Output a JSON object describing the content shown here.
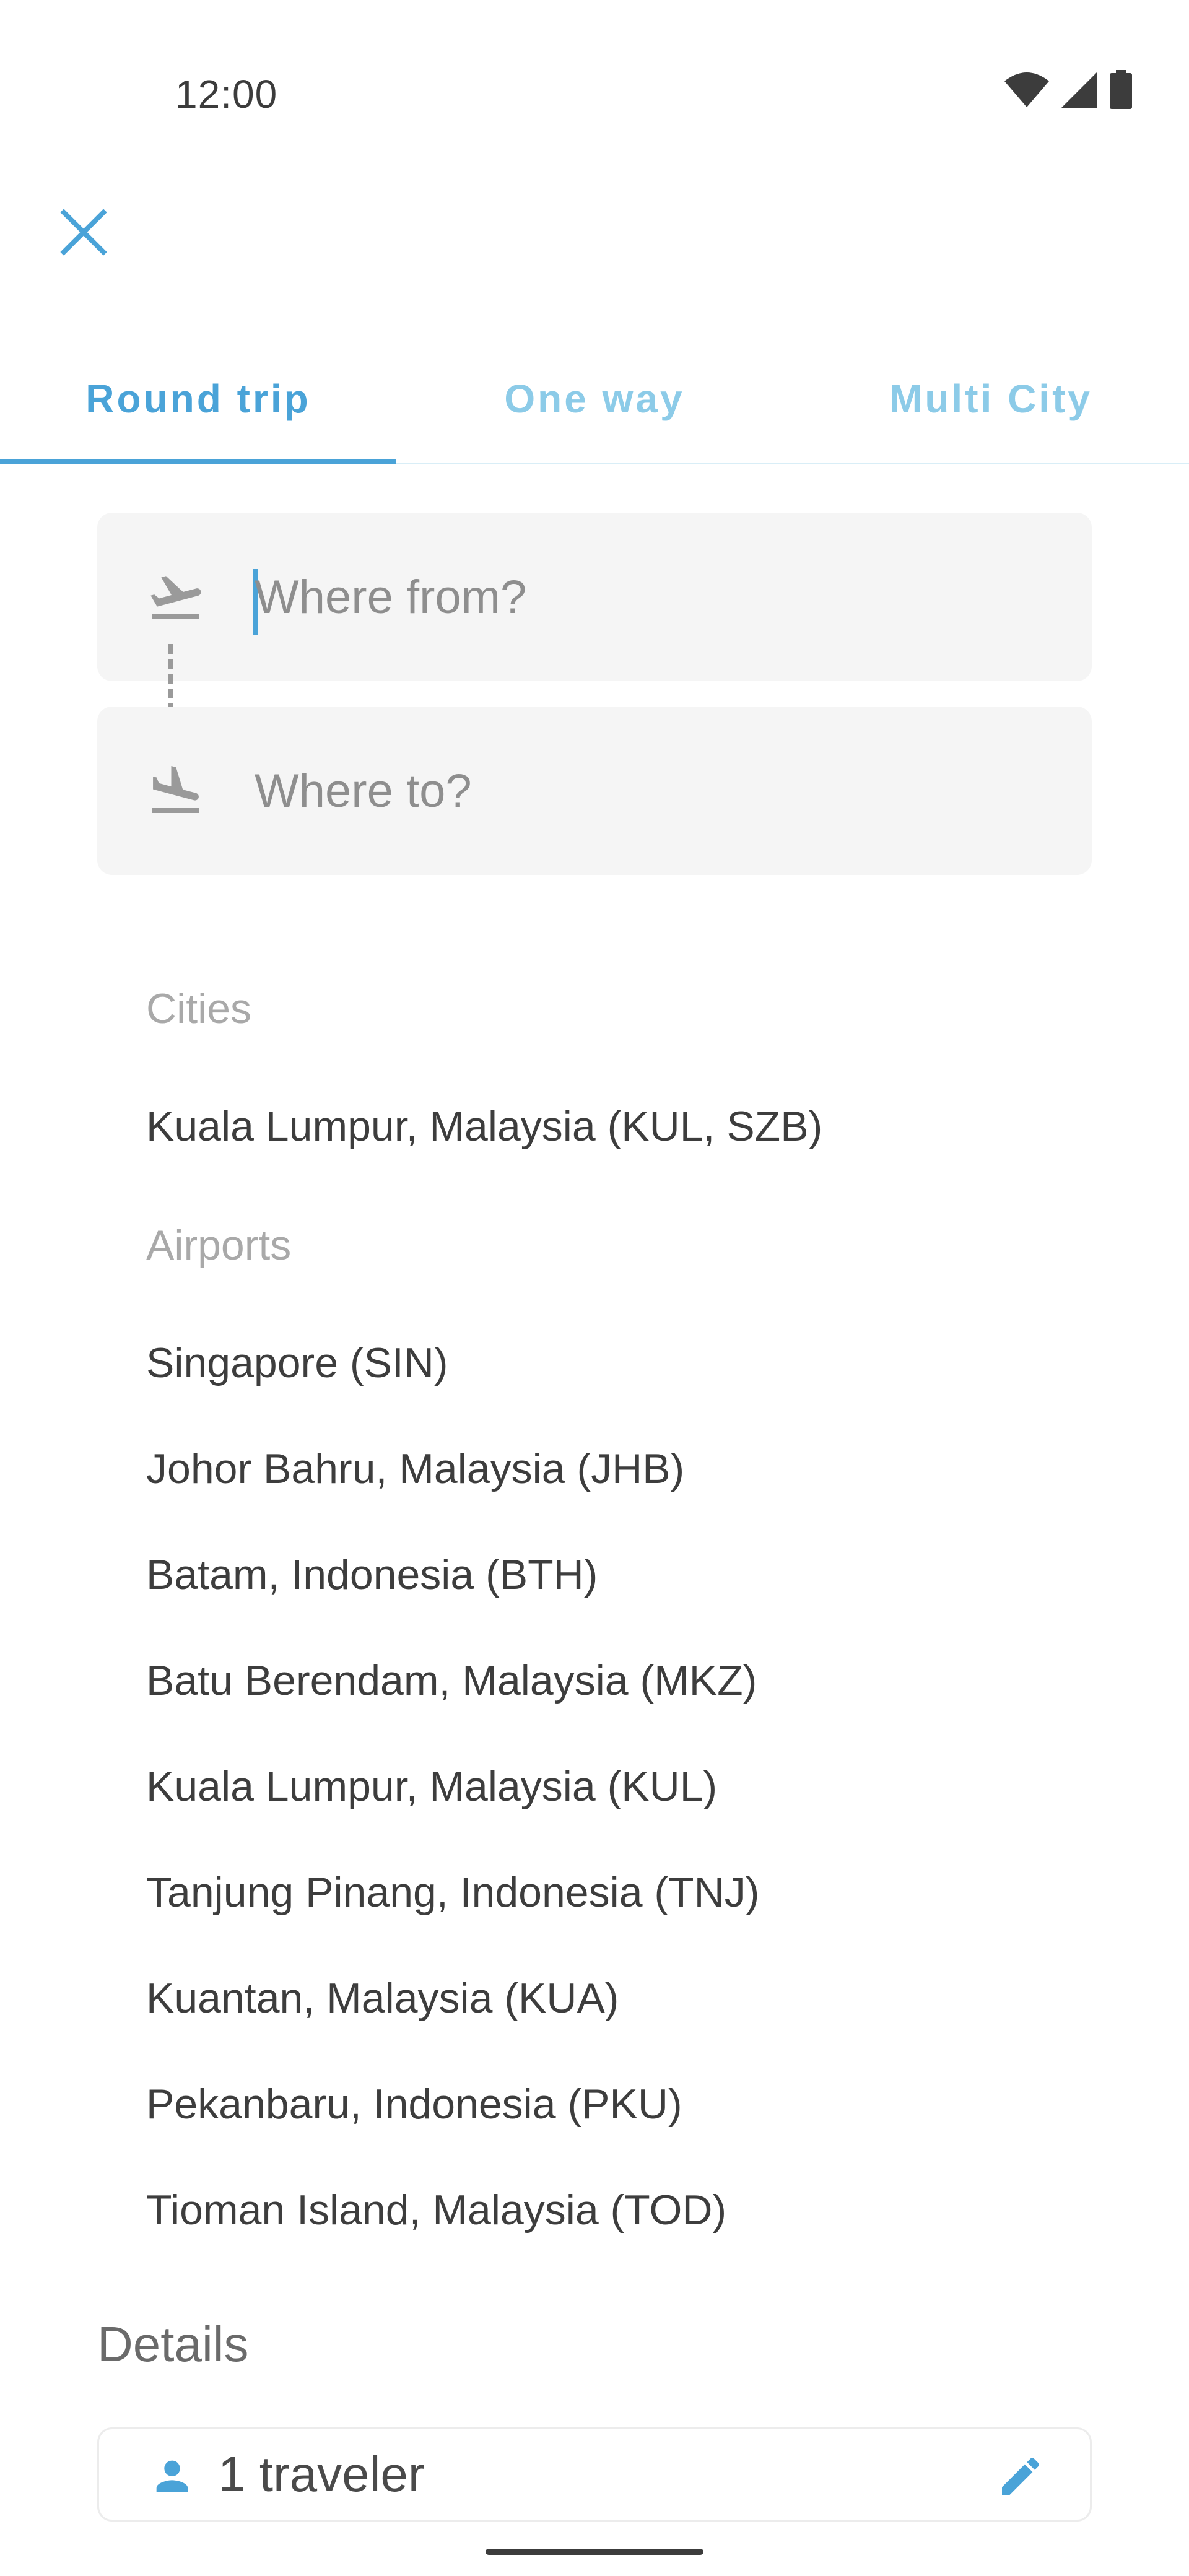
{
  "status_bar": {
    "time": "12:00",
    "icons": [
      "wifi-icon",
      "cellular-signal-icon",
      "battery-icon"
    ]
  },
  "header": {
    "close_icon": "close-icon"
  },
  "tabs": [
    {
      "label": "Round trip",
      "active": true
    },
    {
      "label": "One way",
      "active": false
    },
    {
      "label": "Multi City",
      "active": false
    }
  ],
  "search": {
    "from_placeholder": "Where from?",
    "to_placeholder": "Where to?",
    "from_icon": "flight-takeoff-icon",
    "to_icon": "flight-land-icon"
  },
  "results": {
    "cities_label": "Cities",
    "cities": [
      "Kuala Lumpur, Malaysia (KUL, SZB)"
    ],
    "airports_label": "Airports",
    "airports": [
      "Singapore (SIN)",
      "Johor Bahru, Malaysia (JHB)",
      "Batam, Indonesia (BTH)",
      "Batu Berendam, Malaysia (MKZ)",
      "Kuala Lumpur, Malaysia (KUL)",
      "Tanjung Pinang, Indonesia (TNJ)",
      "Kuantan, Malaysia (KUA)",
      "Pekanbaru, Indonesia (PKU)",
      "Tioman Island, Malaysia (TOD)"
    ]
  },
  "details": {
    "title": "Details",
    "travelers": "1 traveler",
    "person_icon": "person-icon",
    "edit_icon": "edit-pencil-icon"
  },
  "colors": {
    "accent": "#4aa3d8",
    "accent_light": "#8ccbe8",
    "field_bg": "#f5f5f5",
    "text_primary": "#3d3d3d",
    "text_muted": "#a9a9a9"
  }
}
